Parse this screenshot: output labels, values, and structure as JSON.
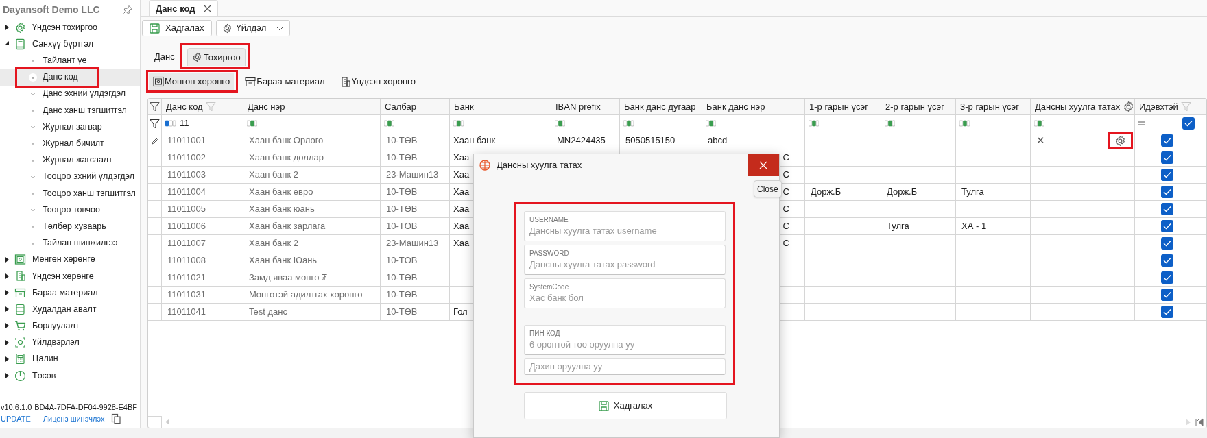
{
  "sidebar": {
    "company": "Dayansoft Demo LLC",
    "items": [
      {
        "label": "Үндсэн тохиргоо",
        "expanded": false
      },
      {
        "label": "Санхүү бүртгэл",
        "expanded": true,
        "children": [
          {
            "label": "Тайлант үе",
            "selected": false,
            "highlighted": false
          },
          {
            "label": "Данс код",
            "selected": true,
            "highlighted": true
          },
          {
            "label": "Данс эхний үлдэгдэл",
            "selected": false,
            "highlighted": false
          },
          {
            "label": "Данс ханш тэгшитгэл",
            "selected": false,
            "highlighted": false
          },
          {
            "label": "Журнал загвар",
            "selected": false,
            "highlighted": false
          },
          {
            "label": "Журнал бичилт",
            "selected": false,
            "highlighted": false
          },
          {
            "label": "Журнал жагсаалт",
            "selected": false,
            "highlighted": false
          },
          {
            "label": "Тооцоо эхний үлдэгдэл",
            "selected": false,
            "highlighted": false
          },
          {
            "label": "Тооцоо ханш тэгшитгэл",
            "selected": false,
            "highlighted": false
          },
          {
            "label": "Тооцоо товчоо",
            "selected": false,
            "highlighted": false
          },
          {
            "label": "Төлбөр хуваарь",
            "selected": false,
            "highlighted": false
          },
          {
            "label": "Тайлан шинжилгээ",
            "selected": false,
            "highlighted": false
          }
        ]
      },
      {
        "label": "Мөнгөн хөрөнгө",
        "expanded": false
      },
      {
        "label": "Үндсэн хөрөнгө",
        "expanded": false
      },
      {
        "label": "Бараа материал",
        "expanded": false
      },
      {
        "label": "Худалдан авалт",
        "expanded": false
      },
      {
        "label": "Борлуулалт",
        "expanded": false
      },
      {
        "label": "Үйлдвэрлэл",
        "expanded": false
      },
      {
        "label": "Цалин",
        "expanded": false
      },
      {
        "label": "Төсөв",
        "expanded": false
      }
    ],
    "footer": {
      "version": "v10.6.1.0",
      "key": "BD4A-7DFA-DF04-9928-E4BF",
      "update": "UPDATE",
      "license": "Лиценз шинэчлэх"
    }
  },
  "document_tab": {
    "label": "Данс код"
  },
  "toolbar": {
    "save": "Хадгалах",
    "actions": "Үйлдэл"
  },
  "sub_tabs": [
    {
      "label": "Данс",
      "selected": false,
      "highlighted": false
    },
    {
      "label": "Тохиргоо",
      "selected": true,
      "highlighted": true
    }
  ],
  "category_buttons": [
    {
      "label": "Мөнгөн хөрөнгө",
      "selected": true,
      "highlighted": true
    },
    {
      "label": "Бараа материал",
      "selected": false,
      "highlighted": false
    },
    {
      "label": "Үндсэн хөрөнгө",
      "selected": false,
      "highlighted": false
    }
  ],
  "table": {
    "columns": [
      {
        "label": "Данс код",
        "readonly": true
      },
      {
        "label": "Данс нэр",
        "readonly": true
      },
      {
        "label": "Салбар",
        "readonly": true
      },
      {
        "label": "Банк",
        "readonly": false
      },
      {
        "label": "IBAN prefix",
        "readonly": false
      },
      {
        "label": "Банк данс дугаар",
        "readonly": false
      },
      {
        "label": "Банк данс нэр",
        "readonly": false
      },
      {
        "label": "1-р гарын үсэг",
        "readonly": false
      },
      {
        "label": "2-р гарын үсэг",
        "readonly": false
      },
      {
        "label": "3-р гарын үсэг",
        "readonly": false
      },
      {
        "label": "Дансны хуулга татах"
      },
      {
        "label": "Идэвхтэй"
      }
    ],
    "filter": {
      "code": "11",
      "active_checked": true
    },
    "rows": [
      {
        "cells": [
          "11011001",
          "Хаан банк Орлого",
          "10-ТӨВ",
          "Хаан банк",
          "MN2424435",
          "5050515150",
          "abcd",
          "",
          "",
          ""
        ],
        "name_cut": false,
        "editing": true,
        "statement_mark": "✕",
        "has_settings": true,
        "settings_highlighted": true,
        "active": true
      },
      {
        "cells": [
          "11011002",
          "Хаан банк доллар",
          "10-ТӨВ",
          "Хаа",
          "",
          "",
          "С",
          "",
          "",
          ""
        ],
        "name_cut": true,
        "editing": false,
        "has_settings": false,
        "active": true
      },
      {
        "cells": [
          "11011003",
          "Хаан банк 2",
          "23-Машин13",
          "Хаа",
          "",
          "",
          "С",
          "",
          "",
          ""
        ],
        "name_cut": true,
        "editing": false,
        "has_settings": false,
        "active": true
      },
      {
        "cells": [
          "11011004",
          "Хаан банк евро",
          "10-ТӨВ",
          "Хаа",
          "",
          "",
          "С",
          "Дорж.Б",
          "Дорж.Б",
          "Тулга"
        ],
        "name_cut": true,
        "editing": false,
        "has_settings": false,
        "active": true
      },
      {
        "cells": [
          "11011005",
          "Хаан банк юань",
          "10-ТӨВ",
          "Хаа",
          "",
          "",
          "С",
          "",
          "",
          ""
        ],
        "name_cut": true,
        "editing": false,
        "has_settings": false,
        "active": true
      },
      {
        "cells": [
          "11011006",
          "Хаан банк зарлага",
          "10-ТӨВ",
          "Хаа",
          "",
          "",
          "С",
          "",
          "Тулга",
          "ХА - 1"
        ],
        "name_cut": true,
        "editing": false,
        "has_settings": false,
        "active": true
      },
      {
        "cells": [
          "11011007",
          "Хаан банк 2",
          "23-Машин13",
          "Хаа",
          "",
          "",
          "С",
          "",
          "",
          ""
        ],
        "name_cut": true,
        "editing": false,
        "has_settings": false,
        "active": true
      },
      {
        "cells": [
          "11011008",
          "Хаан банк Юань",
          "10-ТӨВ",
          "",
          "",
          "",
          "",
          "",
          "",
          ""
        ],
        "editing": false,
        "has_settings": false,
        "active": true
      },
      {
        "cells": [
          "11011021",
          "Замд яваа мөнгө ₮",
          "10-ТӨВ",
          "",
          "",
          "",
          "",
          "",
          "",
          ""
        ],
        "editing": false,
        "has_settings": false,
        "active": true
      },
      {
        "cells": [
          "11011031",
          "Мөнгөтэй адилтгах хөрөнгө",
          "10-ТӨВ",
          "",
          "",
          "",
          "",
          "",
          "",
          ""
        ],
        "editing": false,
        "has_settings": false,
        "active": true
      },
      {
        "cells": [
          "11011041",
          "Test данс",
          "10-ТӨВ",
          "Гол",
          "",
          "",
          "",
          "",
          "",
          ""
        ],
        "editing": false,
        "has_settings": false,
        "active": true
      }
    ]
  },
  "dialog": {
    "title": "Дансны хуулга татах",
    "close_tooltip": "Close",
    "form_highlighted": true,
    "fields": [
      {
        "label": "USERNAME",
        "placeholder": "Дансны хуулга татах username"
      },
      {
        "label": "PASSWORD",
        "placeholder": "Дансны хуулга татах password"
      },
      {
        "label": "SystemCode",
        "placeholder": "Хас банк бол"
      },
      {
        "label": "ПИН КОД",
        "placeholder": "6 оронтой тоо оруулна уу"
      },
      {
        "placeholder": "Дахин оруулна уу"
      }
    ],
    "save": "Хадгалах"
  }
}
